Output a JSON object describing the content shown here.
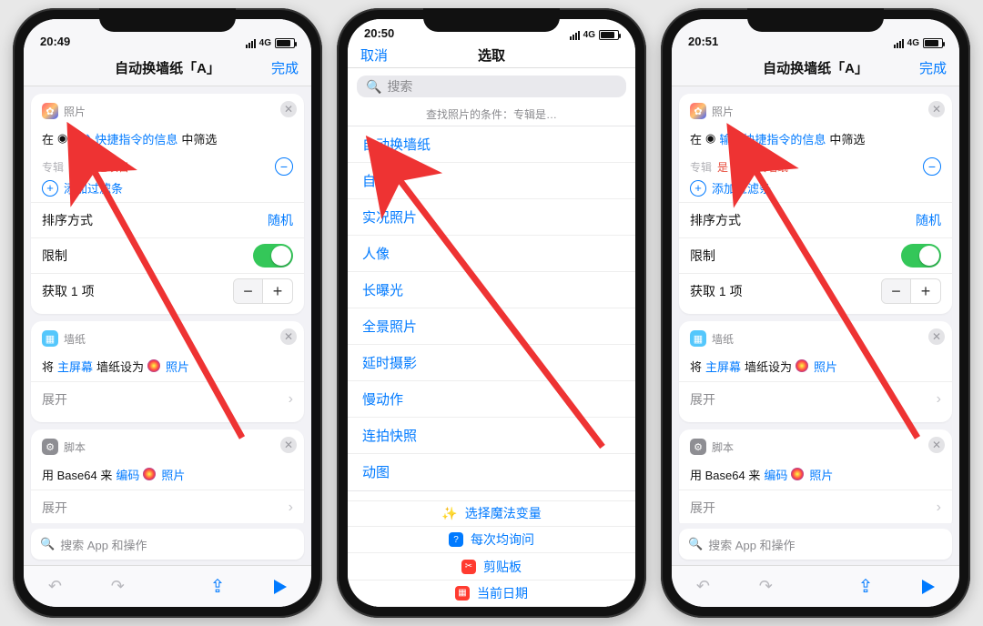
{
  "statusbar": {
    "time1": "20:49",
    "time2": "20:50",
    "time3": "20:51",
    "net": "4G"
  },
  "nav": {
    "title_editor": "自动换墙纸「A」",
    "done": "完成",
    "cancel": "取消",
    "picker_title": "选取"
  },
  "photos_card": {
    "head": "照片",
    "line_pre": "在",
    "line_var": "输入快捷指令的信息",
    "line_post": "中筛选",
    "filter_key": "专辑",
    "filter_op": "是",
    "filter_val_recent": "最近项目",
    "filter_val_custom": "自动换墙纸",
    "add_filter": "添加过滤条",
    "sort_label": "排序方式",
    "sort_value": "随机",
    "limit_label": "限制",
    "get_label": "获取 1 项"
  },
  "wall_card": {
    "head": "墙纸",
    "pre": "将",
    "home": "主屏幕",
    "mid": "墙纸设为",
    "photos": "照片",
    "expand": "展开"
  },
  "script_card": {
    "head": "脚本",
    "pre": "用 Base64 来",
    "encode": "编码",
    "photos": "照片",
    "expand": "展开"
  },
  "search": {
    "placeholder_bottom": "搜索 App 和操作",
    "placeholder_top": "搜索"
  },
  "picker": {
    "condition": "查找照片的条件：专辑是…",
    "items": [
      "自动换墙纸",
      "自拍",
      "实况照片",
      "人像",
      "长曝光",
      "全景照片",
      "延时摄影",
      "慢动作",
      "连拍快照",
      "动图"
    ],
    "magic": "选择魔法变量",
    "ask": "每次均询问",
    "clip": "剪贴板",
    "date": "当前日期"
  }
}
